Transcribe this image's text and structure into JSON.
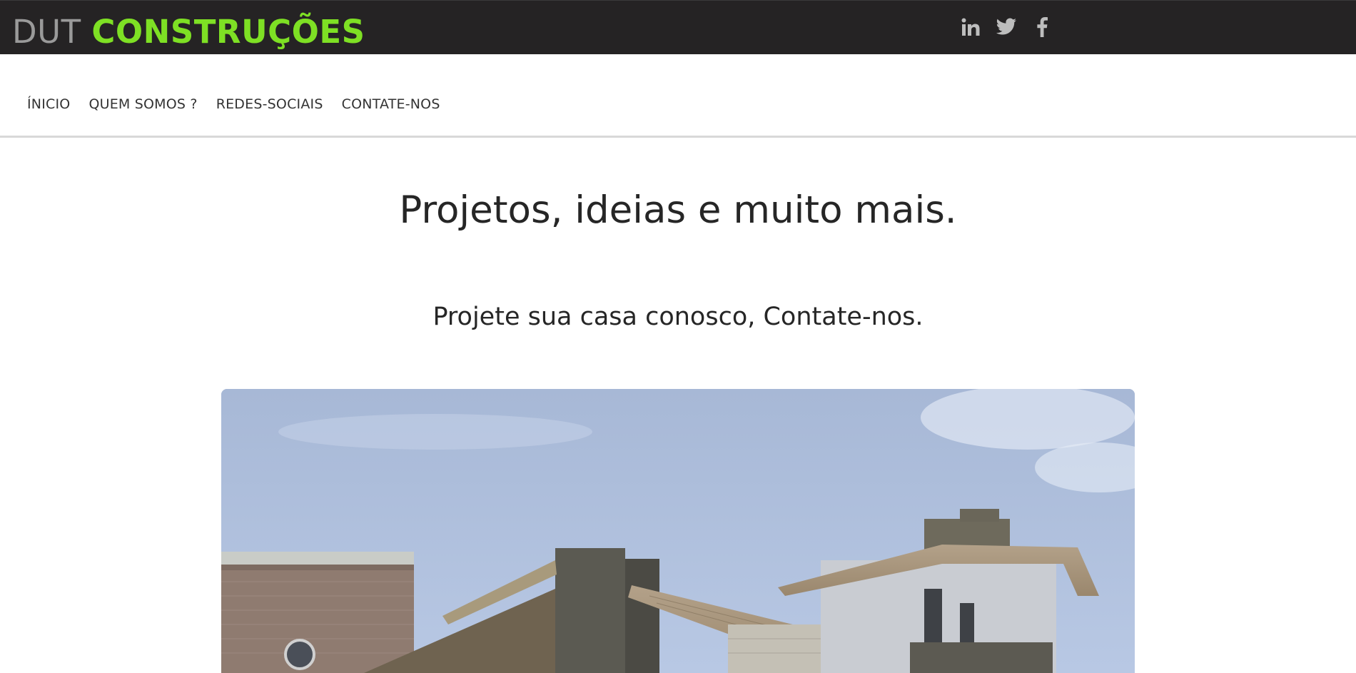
{
  "header": {
    "brand_prefix": "DUT",
    "brand_name": "CONSTRUÇÕES",
    "social_icons": [
      "linkedin-icon",
      "twitter-icon",
      "facebook-icon"
    ],
    "colors": {
      "topbar_bg": "#252324",
      "brand_accent": "#7ee024",
      "brand_muted": "#9a9a9a",
      "icon_color": "#bdbdbd"
    }
  },
  "nav": {
    "items": [
      {
        "label": "ÍNICIO"
      },
      {
        "label": "QUEM SOMOS ?"
      },
      {
        "label": "REDES-SOCIAIS"
      },
      {
        "label": "CONTATE-NOS"
      }
    ]
  },
  "main": {
    "title": "Projetos, ideias e muito mais.",
    "subtitle": "Projete sua casa conosco, Contate-nos."
  }
}
